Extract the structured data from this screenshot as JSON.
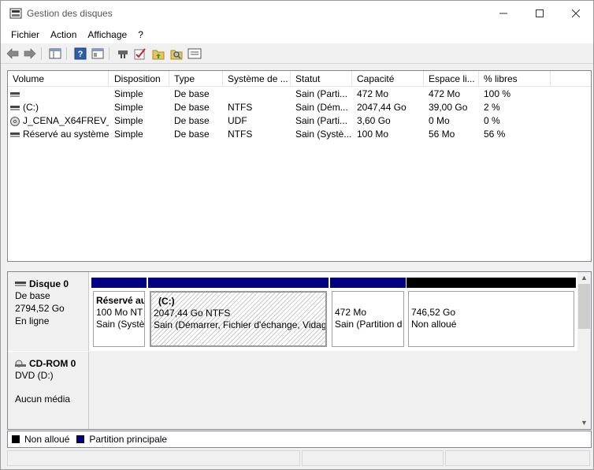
{
  "window": {
    "title": "Gestion des disques",
    "controls": {
      "minimize": "—",
      "maximize": "☐",
      "close": "✕"
    }
  },
  "menu": {
    "items": [
      "Fichier",
      "Action",
      "Affichage",
      "?"
    ]
  },
  "toolbar": {
    "icons": [
      "back-arrow-icon",
      "forward-arrow-icon",
      "list-view-icon",
      "help-icon",
      "properties-icon",
      "connect-icon",
      "check-icon",
      "folder-up-icon",
      "search-folder-icon",
      "console-icon"
    ]
  },
  "volumes": {
    "columns": [
      "Volume",
      "Disposition",
      "Type",
      "Système de ...",
      "Statut",
      "Capacité",
      "Espace li...",
      "% libres"
    ],
    "rows": [
      {
        "volume": "",
        "icon": "disk",
        "disposition": "Simple",
        "type": "De base",
        "fs": "",
        "status": "Sain (Parti...",
        "capacity": "472 Mo",
        "free": "472 Mo",
        "pct": "100 %"
      },
      {
        "volume": "(C:)",
        "icon": "disk",
        "disposition": "Simple",
        "type": "De base",
        "fs": "NTFS",
        "status": "Sain (Dém...",
        "capacity": "2047,44 Go",
        "free": "39,00 Go",
        "pct": "2 %"
      },
      {
        "volume": "J_CENA_X64FREV_...",
        "icon": "cd",
        "disposition": "Simple",
        "type": "De base",
        "fs": "UDF",
        "status": "Sain (Parti...",
        "capacity": "3,60 Go",
        "free": "0 Mo",
        "pct": "0 %"
      },
      {
        "volume": "Réservé au système",
        "icon": "disk",
        "disposition": "Simple",
        "type": "De base",
        "fs": "NTFS",
        "status": "Sain (Systè...",
        "capacity": "100 Mo",
        "free": "56 Mo",
        "pct": "56 %"
      }
    ]
  },
  "disks": {
    "disk0": {
      "name": "Disque 0",
      "type": "De base",
      "size": "2794,52 Go",
      "state": "En ligne",
      "partitions": [
        {
          "title": "Réservé au",
          "size": "100 Mo NT",
          "status": "Sain (Systè",
          "kind": "primary"
        },
        {
          "title": "(C:)",
          "size": "2047,44 Go NTFS",
          "status": "Sain (Démarrer, Fichier d'échange, Vidage",
          "kind": "primary"
        },
        {
          "title": "",
          "size": "472 Mo",
          "status": "Sain (Partition d",
          "kind": "primary"
        },
        {
          "title": "",
          "size": "746,52 Go",
          "status": "Non alloué",
          "kind": "unallocated"
        }
      ]
    },
    "cdrom0": {
      "name": "CD-ROM 0",
      "type": "DVD (D:)",
      "media": "Aucun média"
    }
  },
  "legend": {
    "unallocated": "Non alloué",
    "primary": "Partition principale"
  },
  "colors": {
    "primary": "#000080",
    "unallocated": "#000000"
  }
}
